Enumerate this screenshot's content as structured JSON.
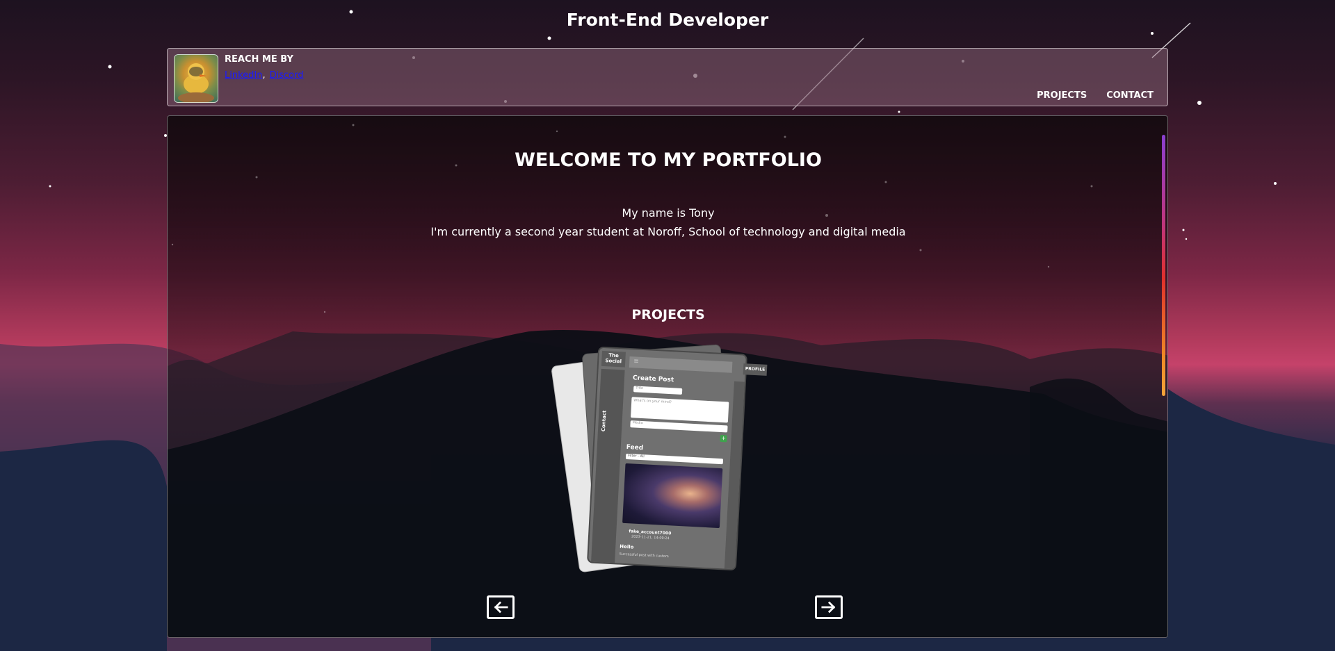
{
  "site": {
    "title": "Front-End Developer"
  },
  "header": {
    "reach_title": "REACH ME BY",
    "links": [
      {
        "label": "LinkedIn"
      },
      {
        "label": "Discord"
      }
    ],
    "link_separator": ",",
    "nav": [
      {
        "label": "PROJECTS"
      },
      {
        "label": "CONTACT"
      }
    ]
  },
  "main": {
    "welcome": "WELCOME TO MY PORTFOLIO",
    "intro_line1": "My name is Tony",
    "intro_line2": "I'm currently a second year student at Noroff, School of technology and digital media",
    "projects_heading": "PROJECTS",
    "carousel": {
      "front_card": {
        "brand": "The Social",
        "profile_button": "PROFILE",
        "create_post_title": "Create Post",
        "title_placeholder": "Title",
        "body_placeholder": "What's on your mind?",
        "media_placeholder": "Media",
        "add_button": "+",
        "side_tab": "Contact",
        "feed_title": "Feed",
        "filter_value": "Filter - All",
        "post_user": "fake_account7000",
        "post_date": "2023-11-21, 14:09:24",
        "post_title": "Hello",
        "post_body": "Successful post with custom"
      },
      "prev_label": "previous",
      "next_label": "next"
    }
  },
  "colors": {
    "accent_scrollbar_top": "#8a3fd1",
    "accent_scrollbar_mid": "#e0302c",
    "accent_scrollbar_bottom": "#f3a43a",
    "link": "#1a1aff",
    "add_button": "#3fa34d"
  }
}
